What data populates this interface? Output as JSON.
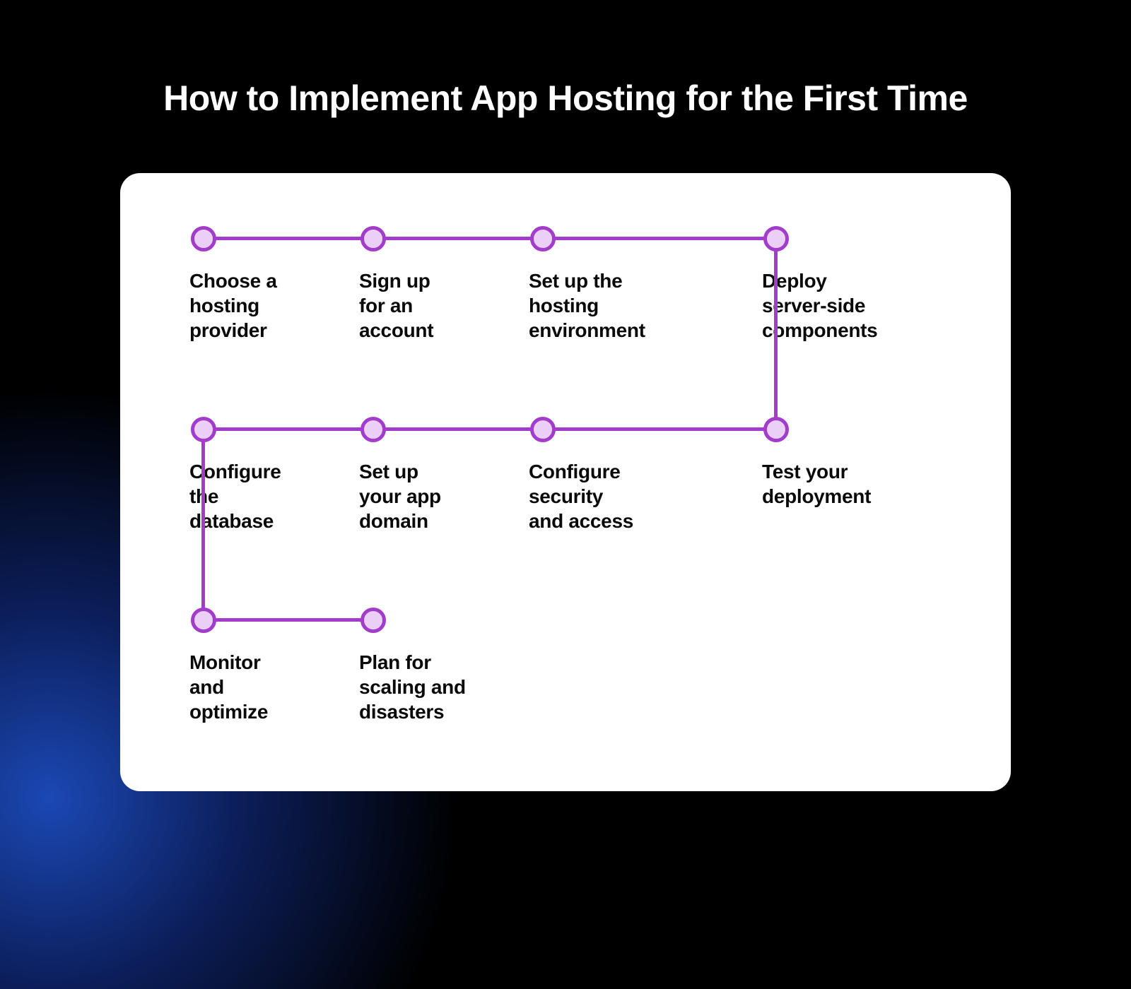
{
  "title": "How to Implement App Hosting for the First Time",
  "colors": {
    "accent": "#A23CCB",
    "node_fill": "#EBCFF7",
    "background": "#000000",
    "card": "#FFFFFF",
    "gradient_blue": "#1E50C8"
  },
  "steps": [
    {
      "order": 1,
      "label": "Choose a\nhosting\nprovider"
    },
    {
      "order": 2,
      "label": "Sign up\nfor an\naccount"
    },
    {
      "order": 3,
      "label": "Set up the\nhosting\nenvironment"
    },
    {
      "order": 4,
      "label": "Deploy\nserver-side\ncomponents"
    },
    {
      "order": 5,
      "label": "Test your\ndeployment"
    },
    {
      "order": 6,
      "label": "Configure\nsecurity\nand access"
    },
    {
      "order": 7,
      "label": "Set up\nyour app\ndomain"
    },
    {
      "order": 8,
      "label": "Configure\nthe\ndatabase"
    },
    {
      "order": 9,
      "label": "Monitor\nand\noptimize"
    },
    {
      "order": 10,
      "label": "Plan for\nscaling and\ndisasters"
    }
  ]
}
